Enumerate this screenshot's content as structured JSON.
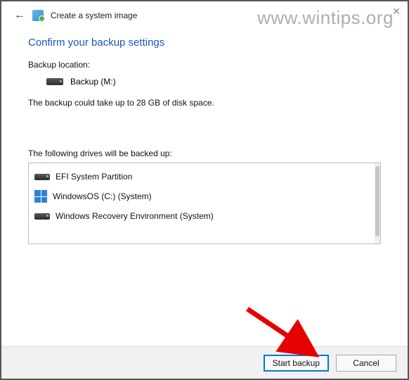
{
  "watermark": "www.wintips.org",
  "window": {
    "title": "Create a system image"
  },
  "heading": "Confirm your backup settings",
  "backup_location": {
    "label": "Backup location:",
    "value": "Backup (M:)"
  },
  "space_estimate": "The backup could take up to 28 GB of disk space.",
  "drives_label": "The following drives will be backed up:",
  "drives": [
    {
      "name": "EFI System Partition",
      "icon": "drive"
    },
    {
      "name": "WindowsOS (C:) (System)",
      "icon": "windows"
    },
    {
      "name": "Windows Recovery Environment (System)",
      "icon": "drive"
    }
  ],
  "buttons": {
    "start": "Start backup",
    "cancel": "Cancel"
  }
}
